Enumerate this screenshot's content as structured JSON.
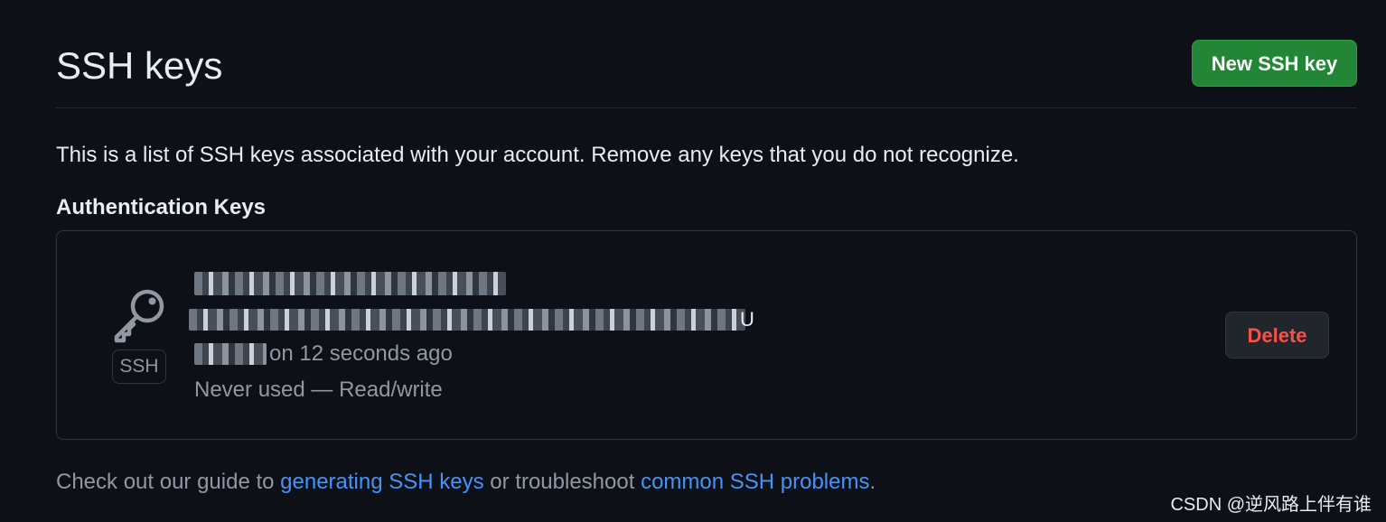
{
  "page": {
    "title": "SSH keys",
    "new_key_button": "New SSH key",
    "intro": "This is a list of SSH keys associated with your account. Remove any keys that you do not recognize.",
    "section_heading": "Authentication Keys"
  },
  "key": {
    "type_badge": "SSH",
    "fingerprint_tail": "U",
    "added_tail": "on 12 seconds ago",
    "usage": "Never used — Read/write",
    "delete_label": "Delete"
  },
  "footer": {
    "prefix": "Check out our guide to ",
    "link1": "generating SSH keys",
    "middle": " or troubleshoot ",
    "link2": "common SSH problems",
    "suffix": "."
  },
  "watermark": "CSDN @逆风路上伴有谁",
  "colors": {
    "background": "#0d1117",
    "primary_button": "#238636",
    "danger": "#f85149",
    "link": "#4493f8",
    "muted": "#9198a1"
  },
  "icons": {
    "key": "key-icon"
  }
}
